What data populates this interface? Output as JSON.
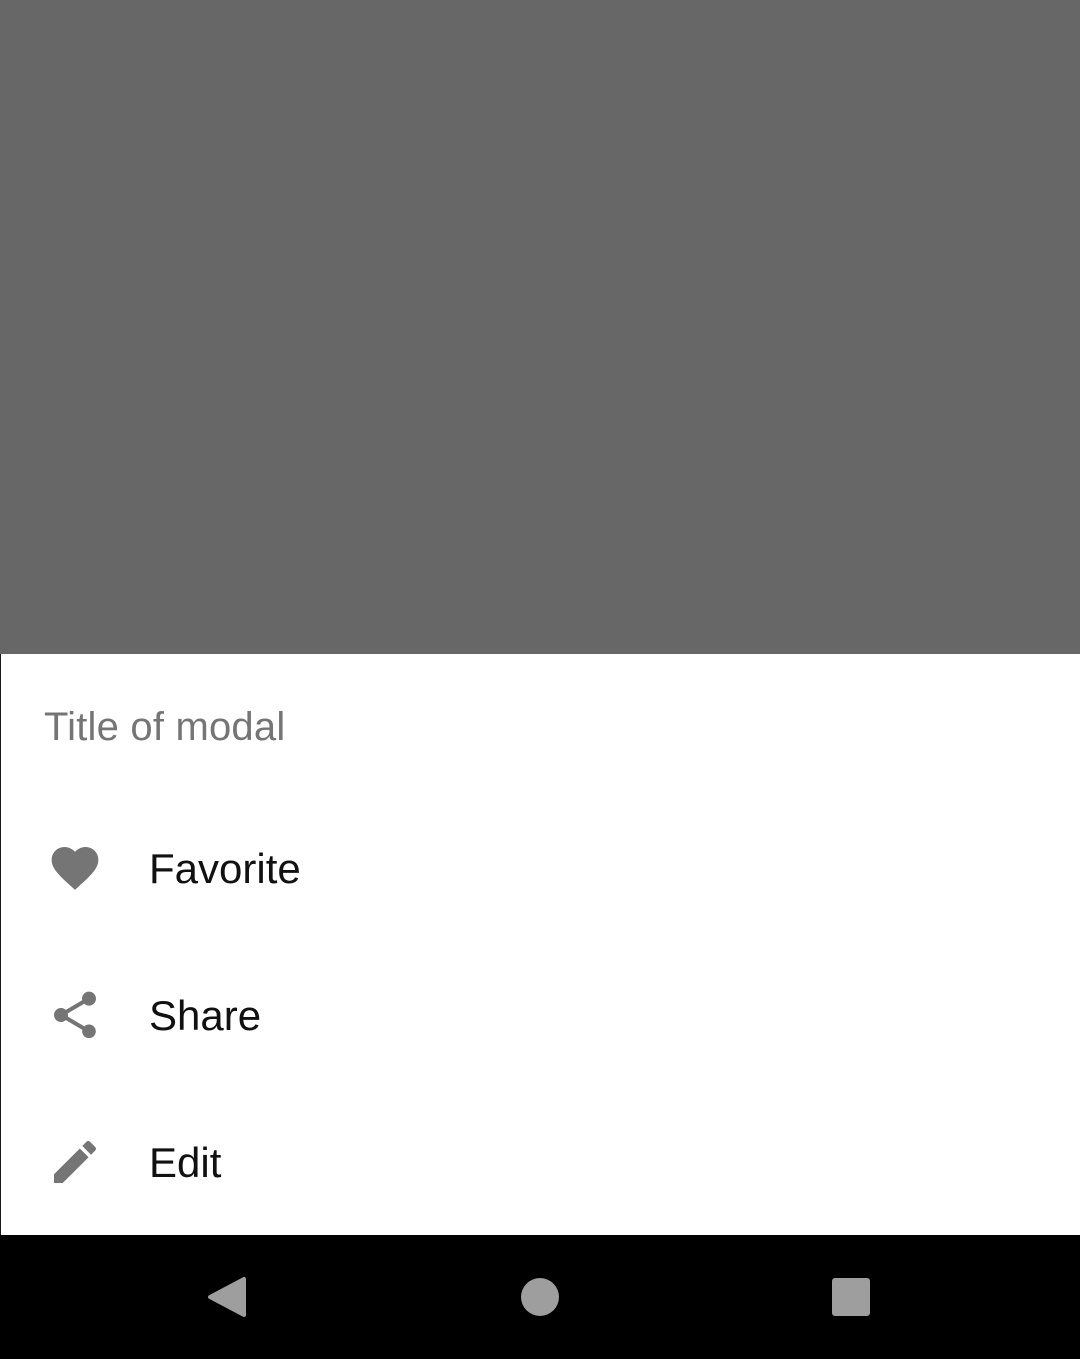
{
  "modal": {
    "title": "Title of modal",
    "items": [
      {
        "label": "Favorite",
        "icon": "heart-icon"
      },
      {
        "label": "Share",
        "icon": "share-icon"
      },
      {
        "label": "Edit",
        "icon": "pencil-icon"
      }
    ]
  },
  "navbar": {
    "buttons": [
      {
        "icon": "back-triangle-icon"
      },
      {
        "icon": "home-circle-icon"
      },
      {
        "icon": "recents-square-icon"
      }
    ]
  },
  "colors": {
    "scrim": "#676767",
    "sheet": "#ffffff",
    "icon": "#757575",
    "title": "#757575",
    "label": "#111111",
    "navbar": "#000000",
    "nav_icon": "#9e9e9e"
  }
}
